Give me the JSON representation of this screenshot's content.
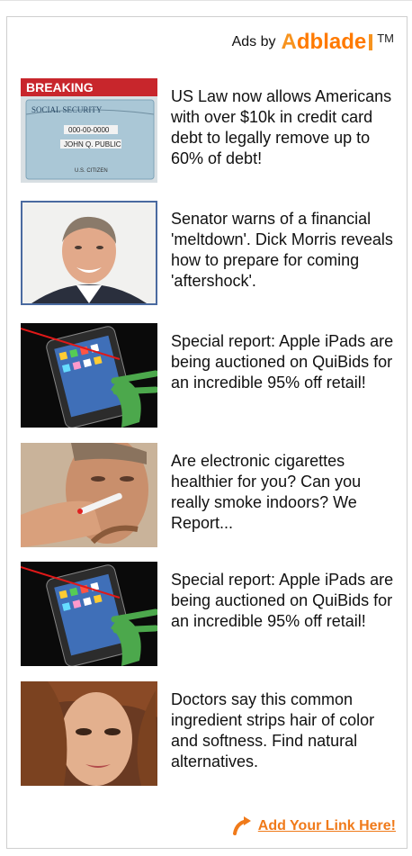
{
  "header": {
    "ads_by": "Ads by",
    "brand_a": "A",
    "brand_rest": "dblade",
    "brand_tm": "TM"
  },
  "ads": [
    {
      "text": "US Law now allows Americans with over $10k in credit card debt to legally remove up to 60% of debt!",
      "thumb_caption": "BREAKING",
      "card_lines": [
        "SOCIAL SECURITY",
        "000-00-0000",
        "JOHN Q. PUBLIC",
        "U.S. CITIZEN"
      ]
    },
    {
      "text": "Senator warns of a financial 'meltdown'. Dick Morris reveals how to prepare for coming 'aftershock'."
    },
    {
      "text": "Special report: Apple iPads are being auctioned on QuiBids for an incredible 95% off retail!"
    },
    {
      "text": "Are electronic cigarettes healthier for you? Can you really smoke indoors? We Report..."
    },
    {
      "text": "Special report: Apple iPads are being auctioned on QuiBids for an incredible 95% off retail!"
    },
    {
      "text": "Doctors say this common ingredient strips hair of color and softness. Find natural alternatives."
    }
  ],
  "footer": {
    "link_label": "Add Your Link Here!"
  },
  "colors": {
    "brand_orange": "#f7931e",
    "link_orange": "#f07a1a"
  }
}
